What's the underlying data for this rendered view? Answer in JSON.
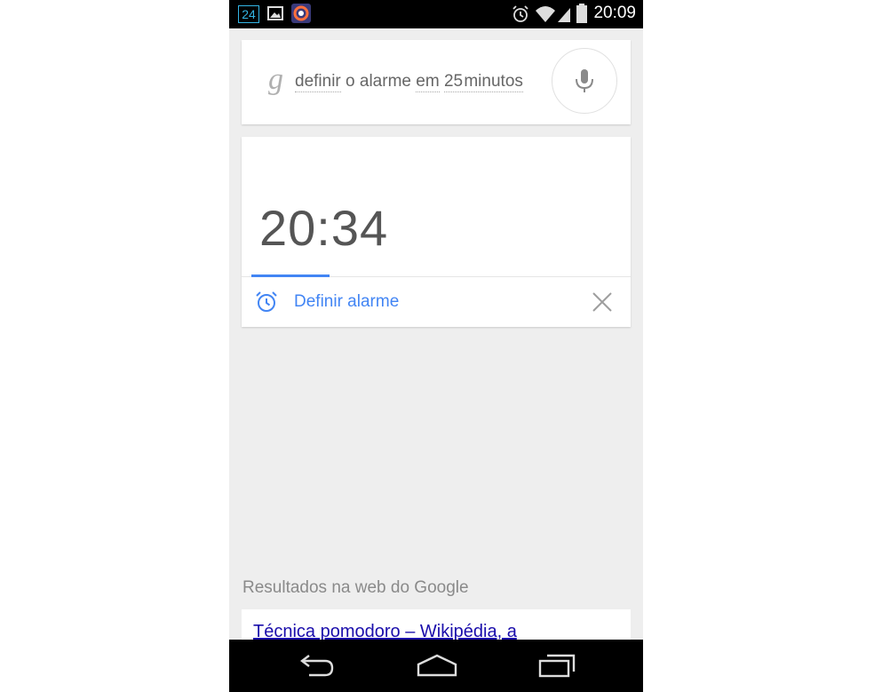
{
  "status_bar": {
    "notification_24": "24",
    "time": "20:09",
    "icons": [
      "calendar-24-icon",
      "image-icon",
      "app-icon",
      "alarm-icon",
      "wifi-icon",
      "signal-icon",
      "battery-icon"
    ]
  },
  "search": {
    "logo": "g",
    "query_words": [
      "definir",
      "o",
      "alarme",
      "em",
      "25",
      "minutos"
    ],
    "mic_icon": "microphone-icon"
  },
  "alarm": {
    "time": "20:34",
    "set_label": "Definir alarme",
    "accent_color": "#4285f4"
  },
  "web_results": {
    "header": "Resultados na web do Google",
    "first_result_title": "Técnica pomodoro – Wikipédia, a"
  },
  "nav_bar": {
    "buttons": [
      "back-icon",
      "home-icon",
      "recents-icon"
    ]
  }
}
